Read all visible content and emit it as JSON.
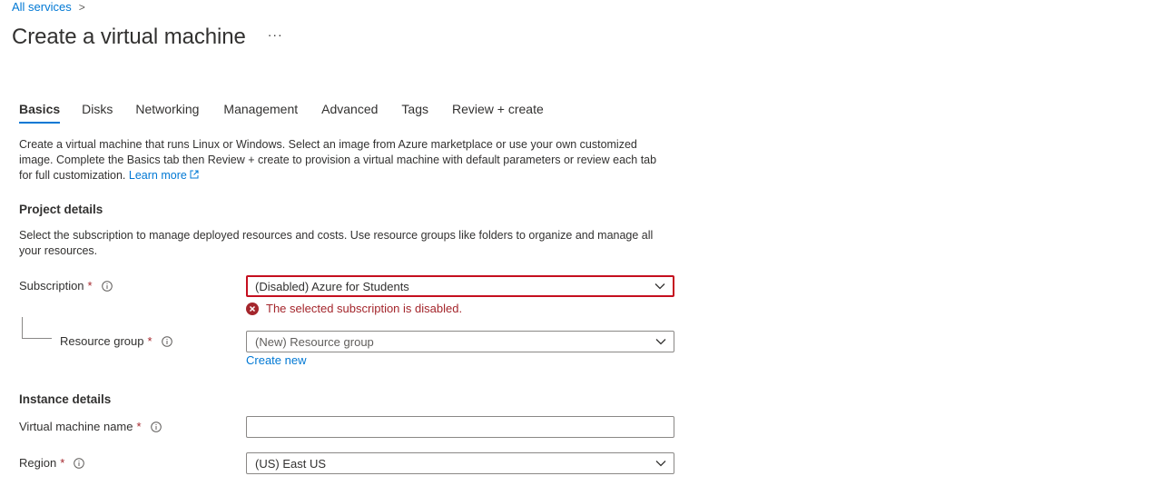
{
  "breadcrumb": {
    "items": [
      "All services"
    ],
    "separator": ">"
  },
  "page": {
    "title": "Create a virtual machine",
    "more_label": "···"
  },
  "tabs": [
    {
      "label": "Basics",
      "active": true
    },
    {
      "label": "Disks",
      "active": false
    },
    {
      "label": "Networking",
      "active": false
    },
    {
      "label": "Management",
      "active": false
    },
    {
      "label": "Advanced",
      "active": false
    },
    {
      "label": "Tags",
      "active": false
    },
    {
      "label": "Review + create",
      "active": false
    }
  ],
  "description": {
    "text": "Create a virtual machine that runs Linux or Windows. Select an image from Azure marketplace or use your own customized image. Complete the Basics tab then Review + create to provision a virtual machine with default parameters or review each tab for full customization.",
    "link": "Learn more"
  },
  "project_details": {
    "title": "Project details",
    "description": "Select the subscription to manage deployed resources and costs. Use resource groups like folders to organize and manage all your resources.",
    "subscription": {
      "label": "Subscription",
      "required_mark": "*",
      "value": "(Disabled) Azure for Students",
      "error": "The selected subscription is disabled."
    },
    "resource_group": {
      "label": "Resource group",
      "required_mark": "*",
      "placeholder": "(New) Resource group",
      "create_new": "Create new"
    }
  },
  "instance_details": {
    "title": "Instance details",
    "vm_name": {
      "label": "Virtual machine name",
      "required_mark": "*",
      "value": ""
    },
    "region": {
      "label": "Region",
      "required_mark": "*",
      "value": "(US) East US"
    }
  },
  "colors": {
    "accent": "#0078d4",
    "error": "#c50f1f",
    "text": "#323130"
  }
}
